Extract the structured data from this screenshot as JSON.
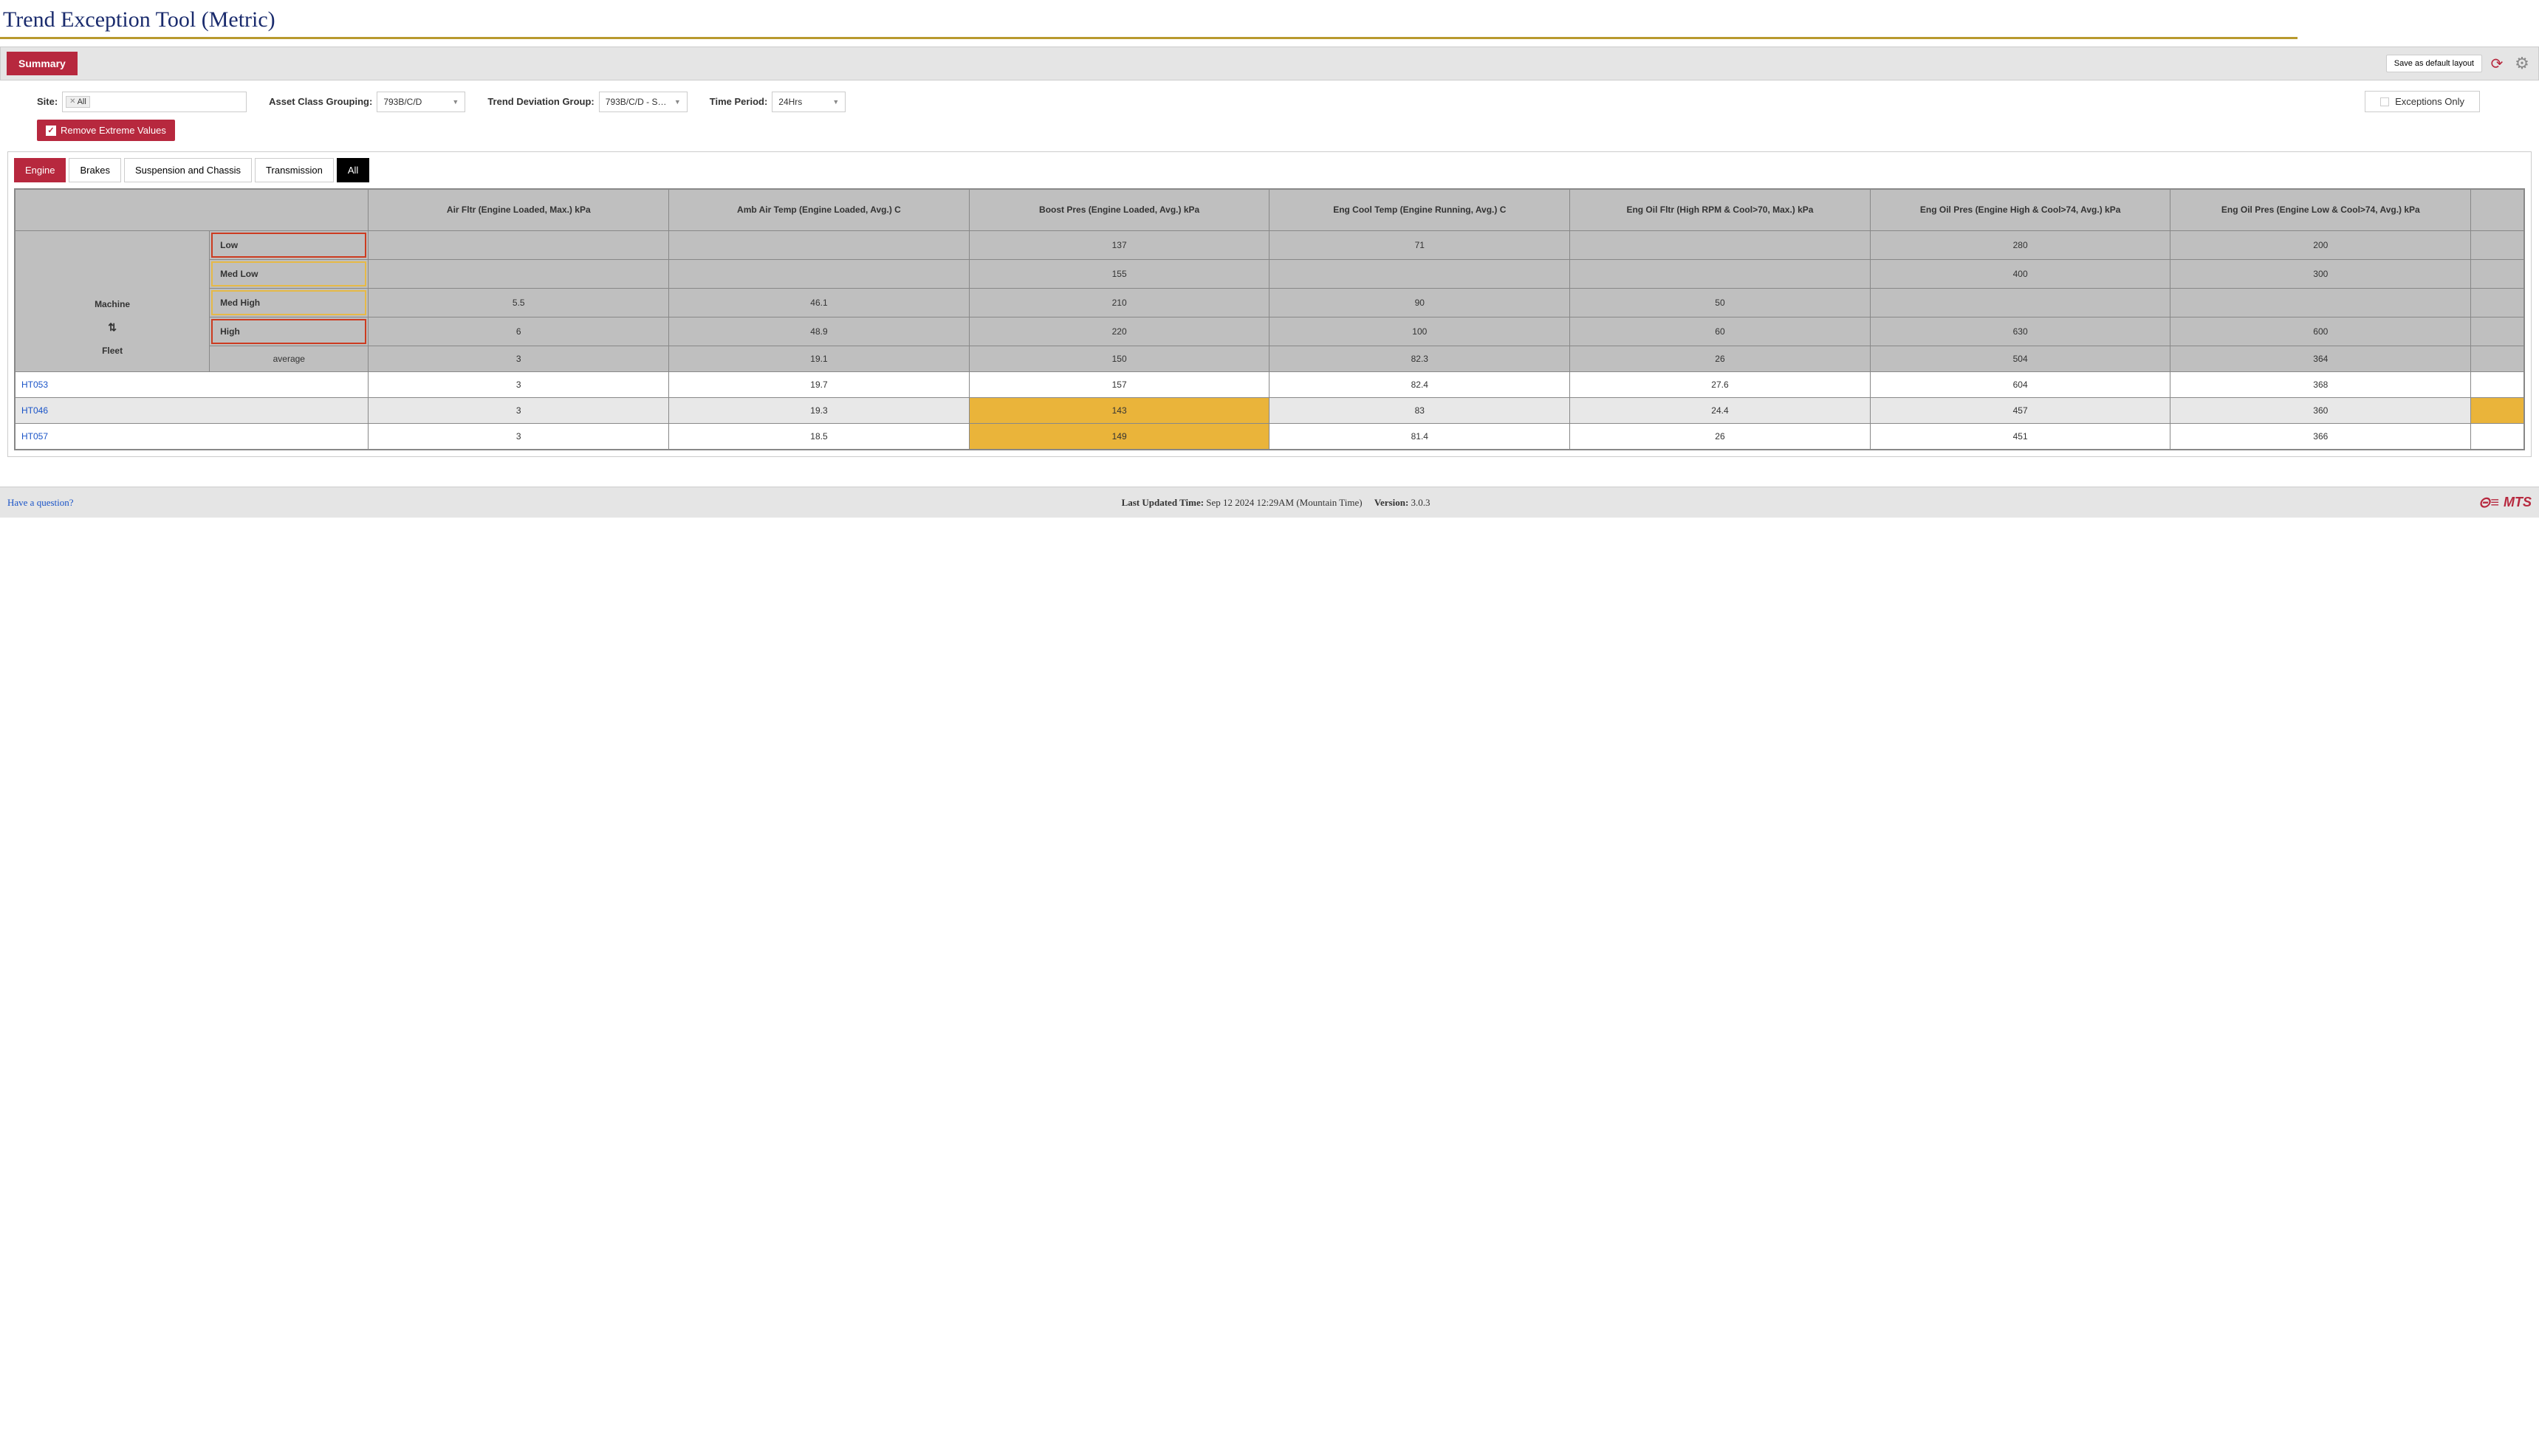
{
  "page_title": "Trend Exception Tool (Metric)",
  "toolbar": {
    "summary_tab": "Summary",
    "save_layout": "Save as default layout"
  },
  "filters": {
    "site_label": "Site:",
    "site_tag": "All",
    "asset_class_label": "Asset Class Grouping:",
    "asset_class_value": "793B/C/D",
    "trend_dev_label": "Trend Deviation Group:",
    "trend_dev_value": "793B/C/D - S…",
    "time_period_label": "Time Period:",
    "time_period_value": "24Hrs",
    "exceptions_only": "Exceptions Only",
    "remove_extreme": "Remove Extreme Values"
  },
  "category_tabs": [
    "Engine",
    "Brakes",
    "Suspension and Chassis",
    "Transmission",
    "All"
  ],
  "table": {
    "machine_header": "Machine",
    "fleet_label": "Fleet",
    "average_label": "average",
    "levels": [
      "Low",
      "Med Low",
      "Med High",
      "High"
    ],
    "columns": [
      "Air Fltr (Engine Loaded, Max.) kPa",
      "Amb Air Temp (Engine Loaded, Avg.) C",
      "Boost Pres (Engine Loaded, Avg.) kPa",
      "Eng Cool Temp (Engine Running, Avg.) C",
      "Eng Oil Fltr (High RPM & Cool>70, Max.) kPa",
      "Eng Oil Pres (Engine High & Cool>74, Avg.) kPa",
      "Eng Oil Pres (Engine Low & Cool>74, Avg.) kPa"
    ],
    "thresholds": {
      "Low": [
        "",
        "",
        "137",
        "71",
        "",
        "280",
        "200"
      ],
      "Med Low": [
        "",
        "",
        "155",
        "",
        "",
        "400",
        "300"
      ],
      "Med High": [
        "5.5",
        "46.1",
        "210",
        "90",
        "50",
        "",
        ""
      ],
      "High": [
        "6",
        "48.9",
        "220",
        "100",
        "60",
        "630",
        "600"
      ]
    },
    "average": [
      "3",
      "19.1",
      "150",
      "82.3",
      "26",
      "504",
      "364"
    ],
    "rows": [
      {
        "machine": "HT053",
        "values": [
          "3",
          "19.7",
          "157",
          "82.4",
          "27.6",
          "604",
          "368"
        ],
        "highlights": []
      },
      {
        "machine": "HT046",
        "values": [
          "3",
          "19.3",
          "143",
          "83",
          "24.4",
          "457",
          "360"
        ],
        "highlights": [
          2
        ]
      },
      {
        "machine": "HT057",
        "values": [
          "3",
          "18.5",
          "149",
          "81.4",
          "26",
          "451",
          "366"
        ],
        "highlights": [
          2
        ]
      }
    ]
  },
  "footer": {
    "question": "Have a question?",
    "updated_label": "Last Updated Time:",
    "updated_value": "Sep 12 2024 12:29AM (Mountain Time)",
    "version_label": "Version:",
    "version_value": "3.0.3",
    "brand": "MTS"
  }
}
